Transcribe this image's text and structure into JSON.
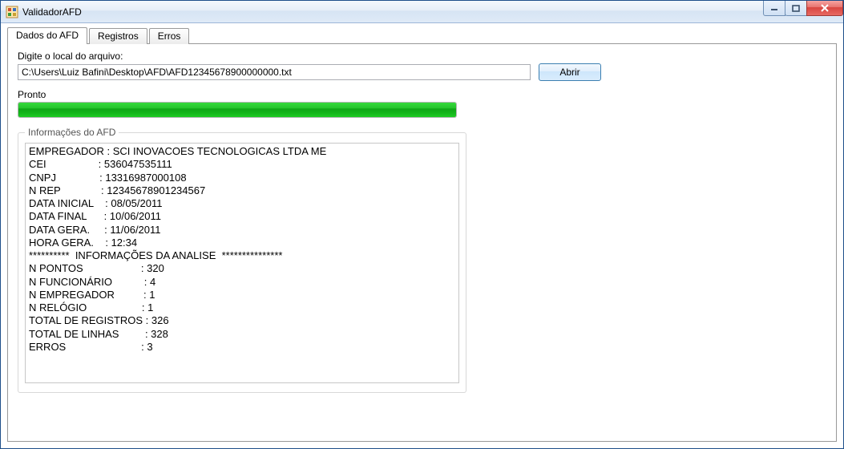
{
  "window": {
    "title": "ValidadorAFD"
  },
  "tabs": {
    "items": [
      {
        "label": "Dados do AFD",
        "active": true
      },
      {
        "label": "Registros",
        "active": false
      },
      {
        "label": "Erros",
        "active": false
      }
    ]
  },
  "file_section": {
    "prompt_label": "Digite o local do arquivo:",
    "path_value": "C:\\Users\\Luiz Bafini\\Desktop\\AFD\\AFD12345678900000000.txt",
    "open_button_label": "Abrir"
  },
  "progress": {
    "status_label": "Pronto",
    "percent": 100
  },
  "info_group": {
    "title": "Informações do AFD",
    "fields": {
      "empregador": "SCI INOVACOES TECNOLOGICAS LTDA ME",
      "cei": "536047535111",
      "cnpj": "13316987000108",
      "n_rep": "12345678901234567",
      "data_inicial": "08/05/2011",
      "data_final": "10/06/2011",
      "data_gera": "11/06/2011",
      "hora_gera": "12:34"
    },
    "analysis_divider": "**********  INFORMAÇÕES DA ANALISE  ***************",
    "analysis": {
      "n_pontos": "320",
      "n_funcionario": "4",
      "n_empregador": "1",
      "n_relogio": "1",
      "total_de_registros": "326",
      "total_de_linhas": "328",
      "erros": "3"
    },
    "rendered_text": "EMPREGADOR : SCI INOVACOES TECNOLOGICAS LTDA ME\nCEI                  : 536047535111\nCNPJ               : 13316987000108\nN REP              : 12345678901234567\nDATA INICIAL    : 08/05/2011\nDATA FINAL      : 10/06/2011\nDATA GERA.     : 11/06/2011\nHORA GERA.    : 12:34\n**********  INFORMAÇÕES DA ANALISE  ***************\nN PONTOS                    : 320\nN FUNCIONÁRIO           : 4\nN EMPREGADOR          : 1\nN RELÓGIO                   : 1\nTOTAL DE REGISTROS : 326\nTOTAL DE LINHAS         : 328\nERROS                          : 3"
  }
}
